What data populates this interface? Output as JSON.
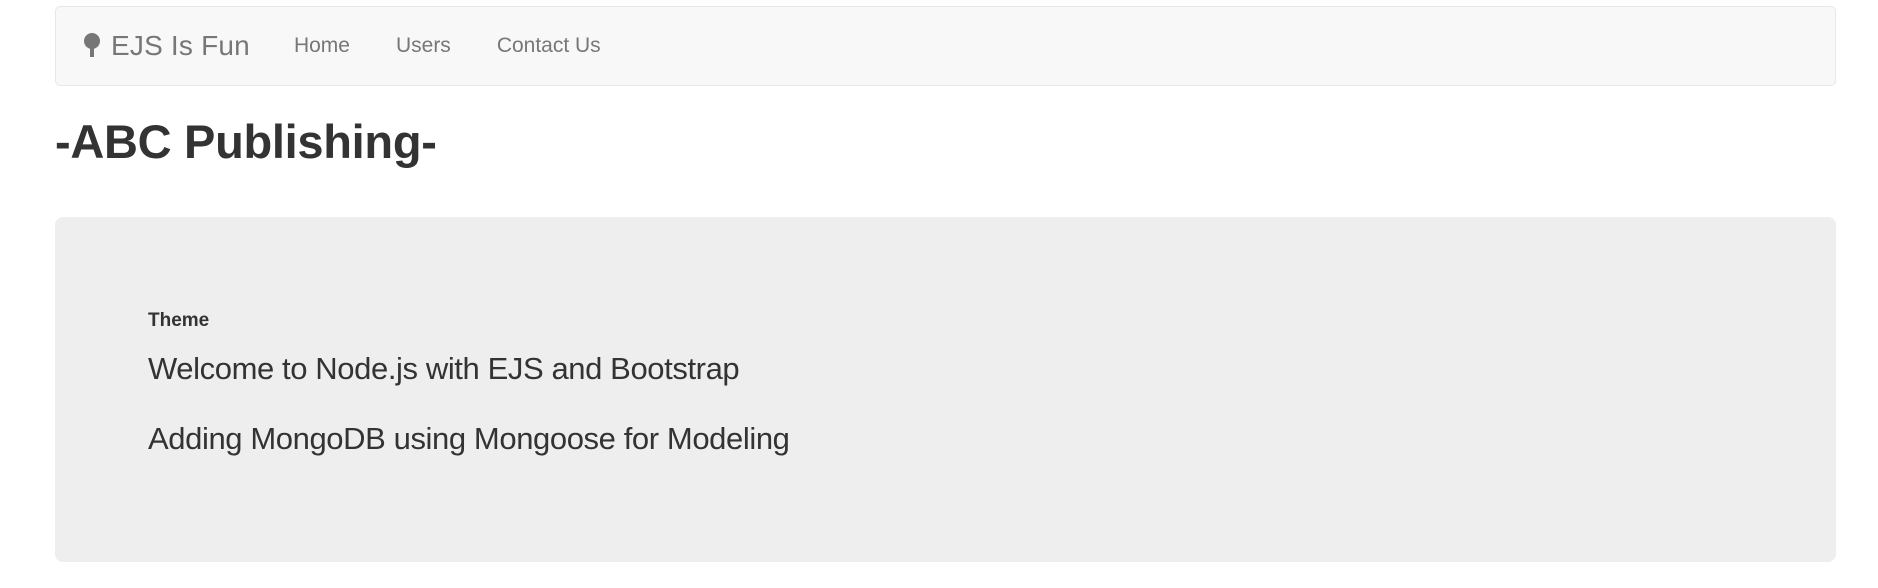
{
  "navbar": {
    "brand": {
      "icon": "tree-icon",
      "label": "EJS Is Fun"
    },
    "links": [
      {
        "label": "Home"
      },
      {
        "label": "Users"
      },
      {
        "label": "Contact Us"
      }
    ]
  },
  "page": {
    "title": "-ABC Publishing-"
  },
  "jumbotron": {
    "heading": "Theme",
    "lines": [
      "Welcome to Node.js with EJS and Bootstrap",
      "Adding MongoDB using Mongoose for Modeling"
    ]
  },
  "colors": {
    "navbar_bg": "#f8f8f8",
    "navbar_border": "#e7e7e7",
    "nav_text": "#777777",
    "jumbotron_bg": "#eeeeee",
    "text": "#333333"
  }
}
